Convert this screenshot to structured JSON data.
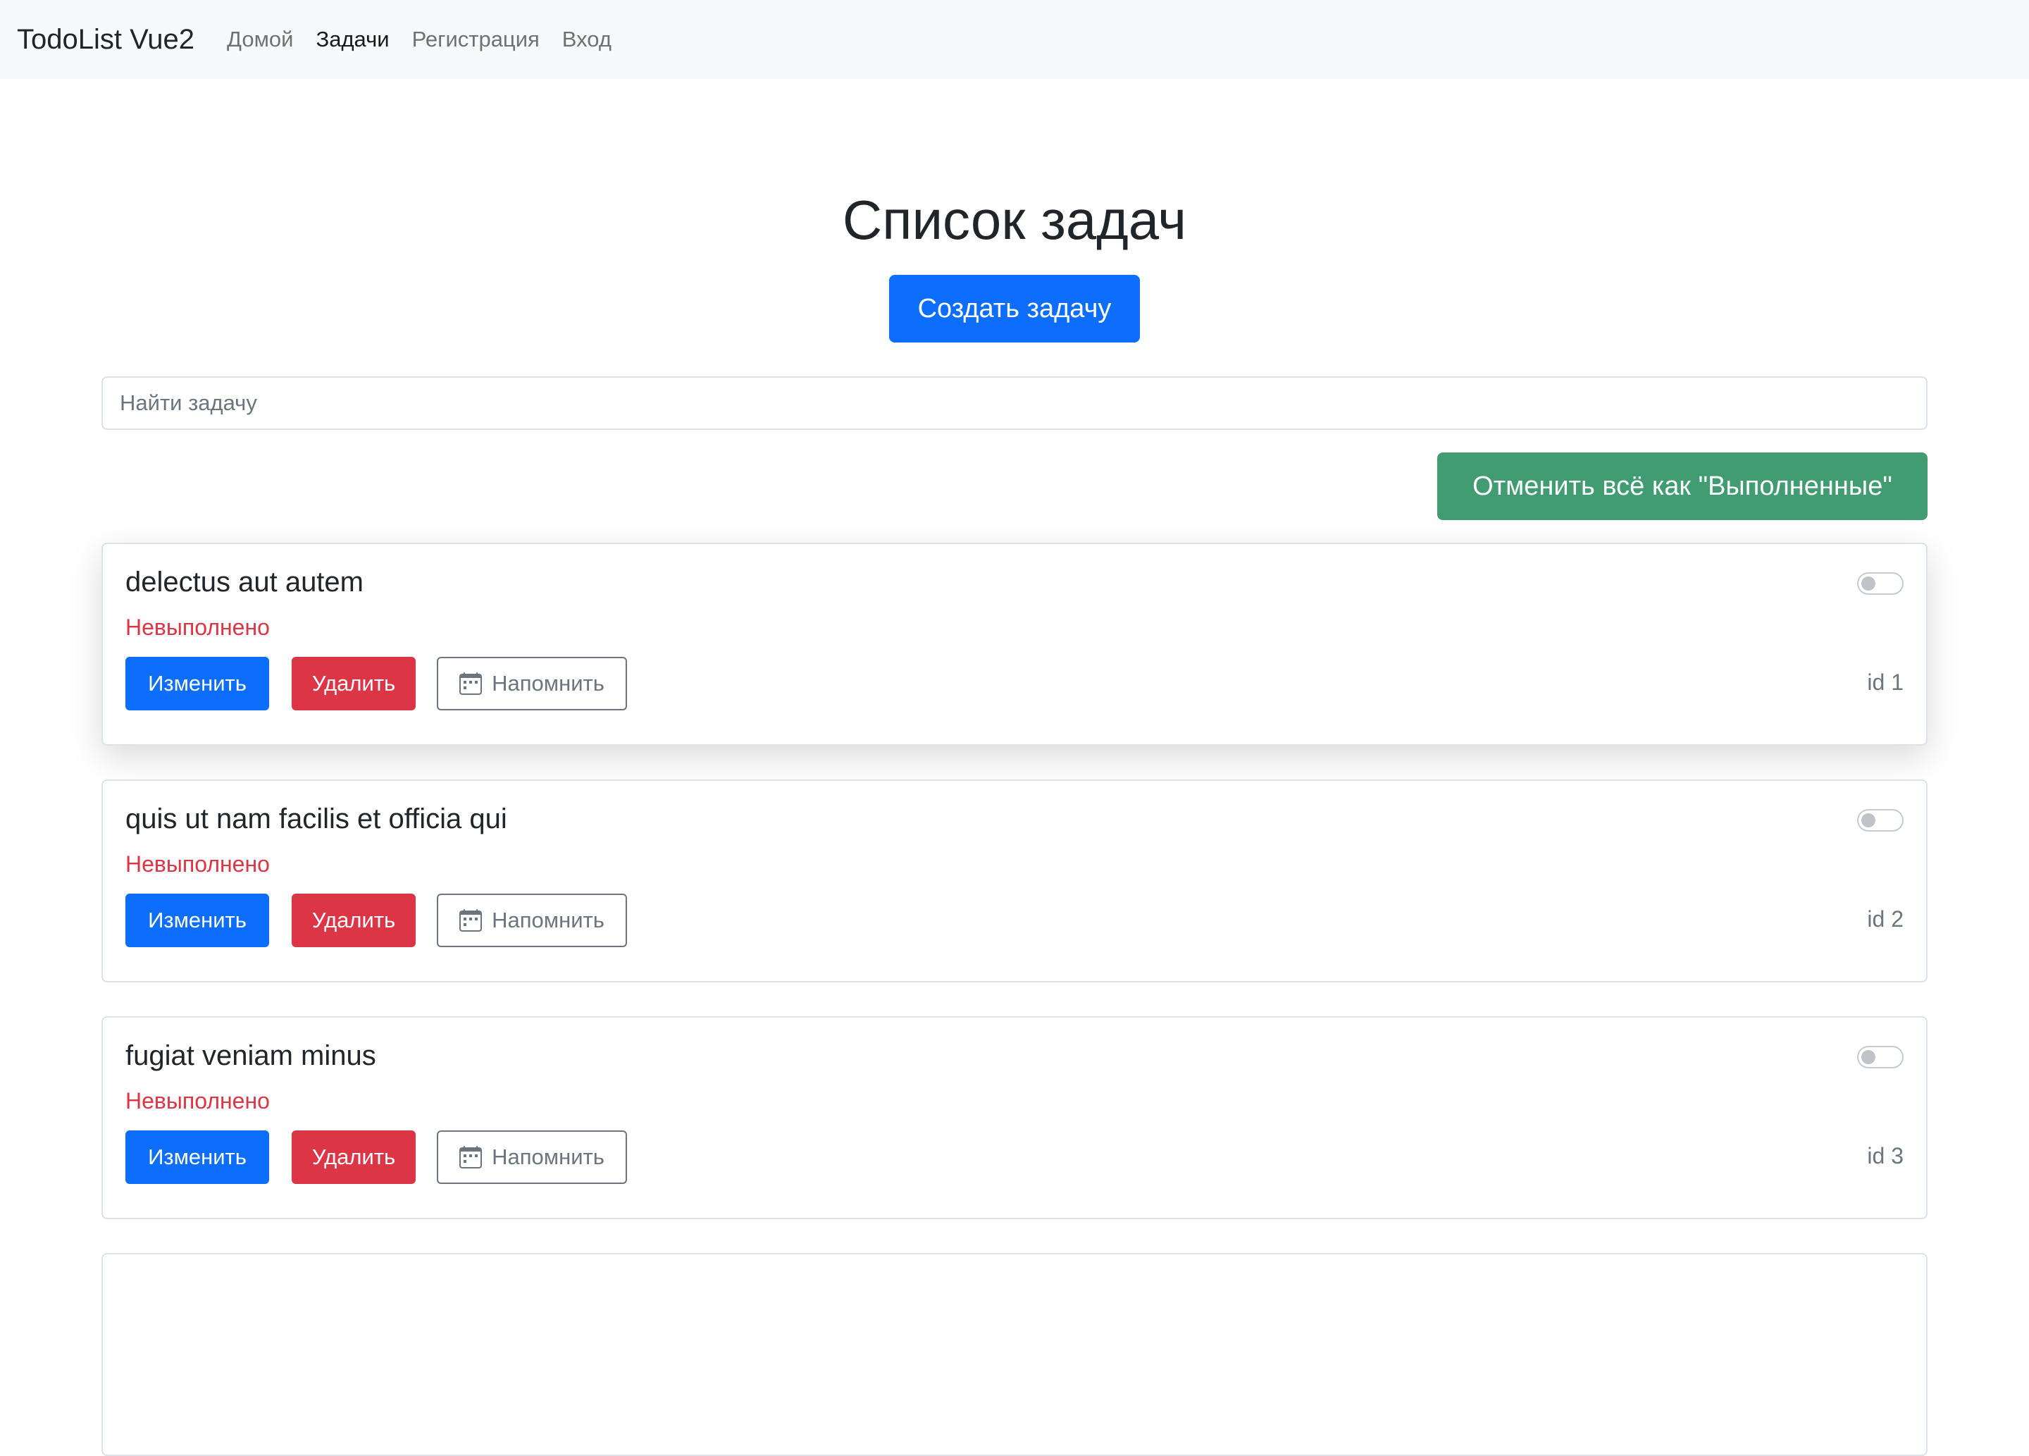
{
  "navbar": {
    "brand": "TodoList Vue2",
    "links": [
      {
        "label": "Домой",
        "active": false
      },
      {
        "label": "Задачи",
        "active": true
      },
      {
        "label": "Регистрация",
        "active": false
      },
      {
        "label": "Вход",
        "active": false
      }
    ]
  },
  "main": {
    "title": "Список задач",
    "create_label": "Создать задачу",
    "search_placeholder": "Найти задачу",
    "undo_all_label": "Отменить всё как \"Выполненные\""
  },
  "tasks": [
    {
      "title": "delectus aut autem",
      "status": "Невыполнено",
      "edit_label": "Изменить",
      "delete_label": "Удалить",
      "remind_label": "Напомнить",
      "id_label": "id 1",
      "done": false
    },
    {
      "title": "quis ut nam facilis et officia qui",
      "status": "Невыполнено",
      "edit_label": "Изменить",
      "delete_label": "Удалить",
      "remind_label": "Напомнить",
      "id_label": "id 2",
      "done": false
    },
    {
      "title": "fugiat veniam minus",
      "status": "Невыполнено",
      "edit_label": "Изменить",
      "delete_label": "Удалить",
      "remind_label": "Напомнить",
      "id_label": "id 3",
      "done": false
    }
  ],
  "colors": {
    "primary": "#0d6efd",
    "danger": "#dc3545",
    "success": "#198754",
    "secondary": "#6c757d",
    "navbar_bg": "#f8f9fa"
  },
  "icons": {
    "remind": "calendar-icon"
  }
}
